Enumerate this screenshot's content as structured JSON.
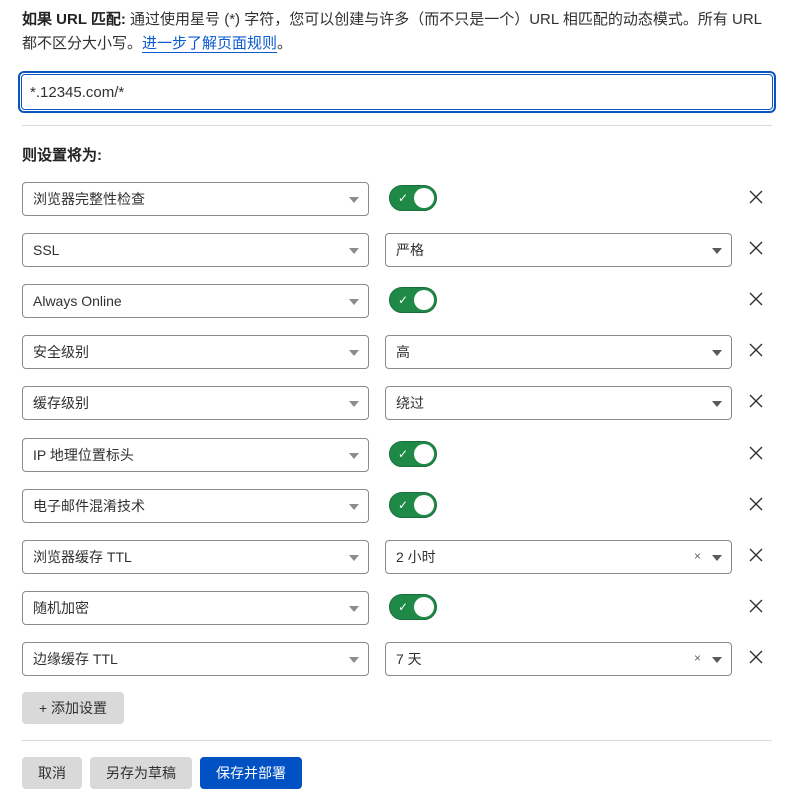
{
  "intro": {
    "label": "如果 URL 匹配:",
    "text": " 通过使用星号 (*) 字符，您可以创建与许多（而不只是一个）URL 相匹配的动态模式。所有 URL 都不区分大小写。",
    "link": "进一步了解页面规则",
    "link_suffix": "。"
  },
  "url_input": {
    "value": "*.12345.com/*"
  },
  "settings_title": "则设置将为:",
  "rows": [
    {
      "setting": "浏览器完整性检查",
      "type": "toggle",
      "on": true
    },
    {
      "setting": "SSL",
      "type": "select",
      "value": "严格",
      "clearable": false
    },
    {
      "setting": "Always Online",
      "type": "toggle",
      "on": true
    },
    {
      "setting": "安全级别",
      "type": "select",
      "value": "高",
      "clearable": false
    },
    {
      "setting": "缓存级别",
      "type": "select",
      "value": "绕过",
      "clearable": false
    },
    {
      "setting": "IP 地理位置标头",
      "type": "toggle",
      "on": true
    },
    {
      "setting": "电子邮件混淆技术",
      "type": "toggle",
      "on": true
    },
    {
      "setting": "浏览器缓存 TTL",
      "type": "select",
      "value": "2 小时",
      "clearable": true
    },
    {
      "setting": "随机加密",
      "type": "toggle",
      "on": true
    },
    {
      "setting": "边缘缓存 TTL",
      "type": "select",
      "value": "7 天",
      "clearable": true
    }
  ],
  "icons": {
    "toggle_check": "✓",
    "clear": "×"
  },
  "buttons": {
    "add_setting": "+ 添加设置",
    "cancel": "取消",
    "save_draft": "另存为草稿",
    "save_deploy": "保存并部署"
  },
  "colors": {
    "accent": "#0051c3",
    "toggle_on": "#1f8a47",
    "link": "#0b5ad1"
  }
}
